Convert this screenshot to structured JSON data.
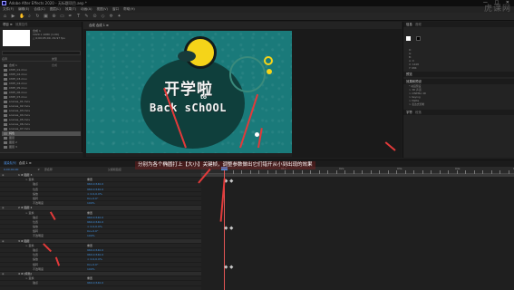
{
  "window": {
    "title": "Adobe After Effects 2020 - 无标题项目.aep *",
    "controls": [
      "—",
      "□",
      "✕"
    ]
  },
  "watermark": "虎课网",
  "menu": [
    "文件(F)",
    "编辑(E)",
    "合成(C)",
    "图层(L)",
    "效果(T)",
    "动画(A)",
    "视图(V)",
    "窗口",
    "帮助(H)"
  ],
  "toolbar": {
    "tools": [
      "home-icon",
      "selection-tool-icon",
      "hand-tool-icon",
      "zoom-tool-icon",
      "rotate-tool-icon",
      "camera-tool-icon",
      "pan-behind-icon",
      "rectangle-tool-icon",
      "pen-tool-icon",
      "text-tool-icon",
      "brush-tool-icon",
      "clone-stamp-icon",
      "eraser-icon",
      "roto-brush-icon",
      "puppet-pin-icon"
    ]
  },
  "project": {
    "tab_label": "项目 ≡",
    "tab2_label": "效果控件",
    "info_lines": [
      "合成 1",
      "1920 x 1080 (1.00)",
      "△ 0;00;05;00, 29.97 fps"
    ],
    "header_name": "名称",
    "header_type": "类型",
    "items": [
      {
        "name": "合成 1",
        "type": "合成",
        "selected": false
      },
      {
        "name": "CMH_01.mov",
        "type": "",
        "selected": false
      },
      {
        "name": "CMH_02.mov",
        "type": "",
        "selected": false
      },
      {
        "name": "CMH_03.mov",
        "type": "",
        "selected": false
      },
      {
        "name": "CMH_04.mov",
        "type": "",
        "selected": false
      },
      {
        "name": "CMH_05.mov",
        "type": "",
        "selected": false
      },
      {
        "name": "CMH_06.mov",
        "type": "",
        "selected": false
      },
      {
        "name": "CMH_07.mov",
        "type": "",
        "selected": false
      },
      {
        "name": "scenes_01.mov",
        "type": "",
        "selected": false
      },
      {
        "name": "scenes_02.mov",
        "type": "",
        "selected": false
      },
      {
        "name": "scenes_03.mov",
        "type": "",
        "selected": false
      },
      {
        "name": "scenes_04.mov",
        "type": "",
        "selected": false
      },
      {
        "name": "scenes_05.mov",
        "type": "",
        "selected": false
      },
      {
        "name": "scenes_06.mov",
        "type": "",
        "selected": false
      },
      {
        "name": "scenes_07.mov",
        "type": "",
        "selected": false
      },
      {
        "name": "纯色",
        "type": "",
        "selected": true
      },
      {
        "name": "图层",
        "type": "",
        "selected": false
      },
      {
        "name": "图层 2",
        "type": "",
        "selected": false
      },
      {
        "name": "图层 3",
        "type": "",
        "selected": false
      }
    ]
  },
  "composition": {
    "tab_label": "合成 合成 1 ≡",
    "title_cn": "开学啦",
    "title_to": "to",
    "title_en": "Back sChOOL",
    "colors": {
      "bg": "#1a7a7a",
      "yellow": "#f5d419",
      "dark": "#0f3f3c"
    }
  },
  "right_panel": {
    "info_tab": "信息",
    "audio_tab": "音频",
    "preview_tab": "预览",
    "effects_tab": "效果和预设",
    "character_tab": "字符",
    "paragraph_tab": "段落",
    "lines": [
      "R:",
      "G:",
      "B:",
      "A: 0",
      "X: 1448",
      "Y: 684",
      "* 动画预设",
      "> 3D 声道",
      "> CINEMA 4D",
      "> Keying",
      "> Matte",
      "> 表达式控制"
    ]
  },
  "timeline": {
    "tab_label": "合成 1 ≡",
    "render_queue": "渲染队列",
    "timecode": "0;00;00;00",
    "column_headers": [
      "#",
      "源名称",
      "父级和链接"
    ],
    "layers": [
      {
        "indent": 0,
        "label": "1  ★ 图层 3",
        "value": "",
        "kind": "head"
      },
      {
        "indent": 1,
        "label": "> 变换",
        "value": "重置",
        "kind": "white"
      },
      {
        "indent": 2,
        "label": "锚点",
        "value": "960.0,540.0",
        "kind": "blue"
      },
      {
        "indent": 2,
        "label": "位置",
        "value": "960.0,540.0",
        "kind": "blue"
      },
      {
        "indent": 2,
        "label": "缩放",
        "value": "∞ 0.0,0.0%",
        "kind": "blue"
      },
      {
        "indent": 2,
        "label": "旋转",
        "value": "0x+0.0°",
        "kind": "blue"
      },
      {
        "indent": 2,
        "label": "不透明度",
        "value": "100%",
        "kind": "blue"
      },
      {
        "indent": 0,
        "label": "2  ★ 图层 2",
        "value": "",
        "kind": "head"
      },
      {
        "indent": 1,
        "label": "> 变换",
        "value": "重置",
        "kind": "white"
      },
      {
        "indent": 2,
        "label": "锚点",
        "value": "960.0,540.0",
        "kind": "blue"
      },
      {
        "indent": 2,
        "label": "位置",
        "value": "960.0,540.0",
        "kind": "blue"
      },
      {
        "indent": 2,
        "label": "缩放",
        "value": "∞ 0.0,0.0%",
        "kind": "blue"
      },
      {
        "indent": 2,
        "label": "旋转",
        "value": "0x+0.0°",
        "kind": "blue"
      },
      {
        "indent": 2,
        "label": "不透明度",
        "value": "100%",
        "kind": "blue"
      },
      {
        "indent": 0,
        "label": "3  ★ 图层",
        "value": "",
        "kind": "head"
      },
      {
        "indent": 1,
        "label": "> 变换",
        "value": "重置",
        "kind": "white"
      },
      {
        "indent": 2,
        "label": "锚点",
        "value": "960.0,540.0",
        "kind": "blue"
      },
      {
        "indent": 2,
        "label": "位置",
        "value": "960.0,540.0",
        "kind": "blue"
      },
      {
        "indent": 2,
        "label": "缩放",
        "value": "∞ 0.0,0.0%",
        "kind": "blue"
      },
      {
        "indent": 2,
        "label": "旋转",
        "value": "0x+0.0°",
        "kind": "blue"
      },
      {
        "indent": 2,
        "label": "不透明度",
        "value": "100%",
        "kind": "blue"
      },
      {
        "indent": 0,
        "label": "4  ★ [纯色]",
        "value": "",
        "kind": "head"
      },
      {
        "indent": 1,
        "label": "> 变换",
        "value": "重置",
        "kind": "white"
      },
      {
        "indent": 2,
        "label": "锚点",
        "value": "960.0,540.0",
        "kind": "blue"
      }
    ],
    "annotation": "分别为各个椭圆打上【大小】关键帧，调整参数做出它们错开从小到出现的效果",
    "ruler_labels": [
      "0s",
      "01s",
      "02s",
      "03s",
      "04s",
      "05s"
    ]
  }
}
